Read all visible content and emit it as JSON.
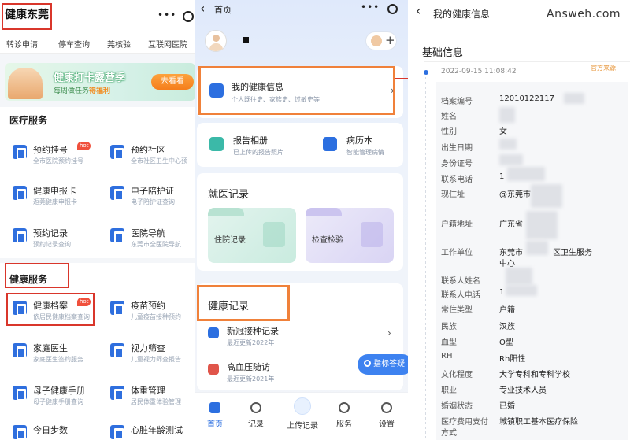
{
  "left_app": {
    "title": "健康东莞",
    "capsule": "•••",
    "nav": [
      "转诊申请",
      "停车查询",
      "莞核验",
      "互联网医院"
    ],
    "banner": {
      "title": "健康打卡露营季",
      "subtitle_prefix": "每周做任务",
      "subtitle_highlight": "得福利",
      "button": "去看看"
    },
    "medical_section": {
      "title": "医疗服务",
      "items": [
        {
          "name": "预约挂号",
          "desc": "全市医院预约挂号",
          "badge": "hot"
        },
        {
          "name": "预约社区",
          "desc": "全市社区卫生中心预"
        },
        {
          "name": "健康申报卡",
          "desc": "返莞健康申报卡"
        },
        {
          "name": "电子陪护证",
          "desc": "电子陪护证查询"
        },
        {
          "name": "预约记录",
          "desc": "预约记录查询"
        },
        {
          "name": "医院导航",
          "desc": "东莞市全医院导航"
        }
      ]
    },
    "health_section": {
      "title": "健康服务",
      "items": [
        {
          "name": "健康档案",
          "desc": "依居民健康档案查询",
          "badge": "hot"
        },
        {
          "name": "疫苗预约",
          "desc": "儿童疫苗接种预约"
        },
        {
          "name": "家庭医生",
          "desc": "家庭医生签约服务"
        },
        {
          "name": "视力筛查",
          "desc": "儿童视力筛查报告"
        },
        {
          "name": "母子健康手册",
          "desc": "母子健康手册查询"
        },
        {
          "name": "体重管理",
          "desc": "居民体重体验管理"
        },
        {
          "name": "今日步数",
          "desc": ""
        },
        {
          "name": "心脏年龄测试",
          "desc": ""
        }
      ]
    }
  },
  "mid_app": {
    "back": "‹",
    "title": "首页",
    "capsule": "•••",
    "my_health_info": {
      "title": "我的健康信息",
      "subtitle": "个人既往史、家族史、过敏史等"
    },
    "report_album": {
      "title": "报告相册",
      "subtitle": "已上传的报告照片"
    },
    "medical_record": {
      "title": "病历本",
      "subtitle": "智能管理病情"
    },
    "visit_records": {
      "title": "就医记录",
      "folders": [
        "住院记录",
        "检查检验"
      ]
    },
    "health_records": {
      "title": "健康记录",
      "items": [
        {
          "title": "新冠接种记录",
          "subtitle": "最近更新2022年"
        },
        {
          "title": "高血压随访",
          "subtitle": "最近更新2021年"
        }
      ]
    },
    "float_button": "指标答疑",
    "tabs": [
      "首页",
      "记录",
      "上传记录",
      "服务",
      "设置"
    ]
  },
  "right_app": {
    "back": "‹",
    "title": "我的健康信息",
    "watermark": "Answ​eh.com",
    "section": "基础信息",
    "timestamp": "2022-09-15 11:08:42",
    "source": "官方来源",
    "fields": [
      {
        "label": "档案编号",
        "value": "12010122117"
      },
      {
        "label": "姓名",
        "value": ""
      },
      {
        "label": "性别",
        "value": "女"
      },
      {
        "label": "出生日期",
        "value": ""
      },
      {
        "label": "身份证号",
        "value": ""
      },
      {
        "label": "联系电话",
        "value": "1"
      },
      {
        "label": "现住址",
        "value": "@东莞市"
      },
      {
        "label": "户籍地址",
        "value": "广东省"
      },
      {
        "label": "工作单位",
        "value": "东莞市",
        "value_b": "区卫生服务",
        "value_c": "中心"
      },
      {
        "label": "联系人姓名",
        "value": ""
      },
      {
        "label": "联系人电话",
        "value": "1"
      },
      {
        "label": "常住类型",
        "value": "户籍"
      },
      {
        "label": "民族",
        "value": "汉族"
      },
      {
        "label": "血型",
        "value": "O型"
      },
      {
        "label": "RH",
        "value": "Rh阳性"
      },
      {
        "label": "文化程度",
        "value": "大学专科和专科学校"
      },
      {
        "label": "职业",
        "value": "专业技术人员"
      },
      {
        "label": "婚姻状态",
        "value": "已婚"
      },
      {
        "label": "医疗费用支付",
        "label_b": "方式",
        "value": "城镇职工基本医疗保险"
      }
    ]
  },
  "colors": {
    "highlight_red": "#d9362b",
    "highlight_orange": "#f0813a",
    "brand_blue": "#2c6fe0"
  }
}
